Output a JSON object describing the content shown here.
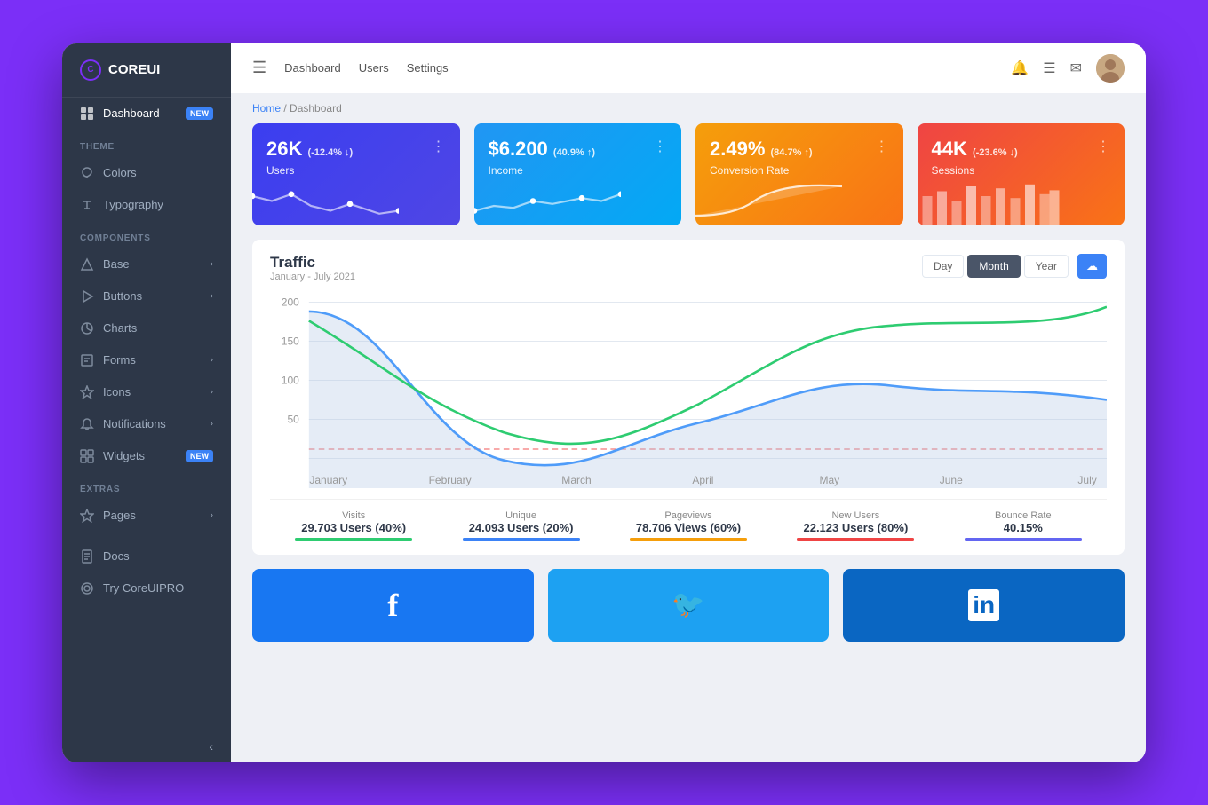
{
  "app": {
    "name": "COREUI"
  },
  "header": {
    "menu_icon": "☰",
    "nav_items": [
      "Dashboard",
      "Users",
      "Settings"
    ],
    "bell_icon": "🔔",
    "list_icon": "☰",
    "mail_icon": "✉"
  },
  "breadcrumb": {
    "home": "Home",
    "separator": "/",
    "current": "Dashboard"
  },
  "stat_cards": [
    {
      "value": "26K",
      "change": "(-12.4% ↓)",
      "label": "Users",
      "color": "card-blue"
    },
    {
      "value": "$6.200",
      "change": "(40.9% ↑)",
      "label": "Income",
      "color": "card-sky"
    },
    {
      "value": "2.49%",
      "change": "(84.7% ↑)",
      "label": "Conversion Rate",
      "color": "card-orange"
    },
    {
      "value": "44K",
      "change": "(-23.6% ↓)",
      "label": "Sessions",
      "color": "card-red"
    }
  ],
  "traffic": {
    "title": "Traffic",
    "subtitle": "January - July 2021",
    "time_buttons": [
      "Day",
      "Month",
      "Year"
    ],
    "active_time": "Month",
    "export_icon": "☁",
    "x_labels": [
      "January",
      "February",
      "March",
      "April",
      "May",
      "June",
      "July"
    ],
    "y_labels": [
      "200",
      "150",
      "100",
      "50"
    ],
    "stats": [
      {
        "label": "Visits",
        "value": "29.703 Users (40%)",
        "bar_color": "#2ecc71"
      },
      {
        "label": "Unique",
        "value": "24.093 Users (20%)",
        "bar_color": "#3b82f6"
      },
      {
        "label": "Pageviews",
        "value": "78.706 Views (60%)",
        "bar_color": "#f59e0b"
      },
      {
        "label": "New Users",
        "value": "22.123 Users (80%)",
        "bar_color": "#ef4444"
      },
      {
        "label": "Bounce Rate",
        "value": "40.15%",
        "bar_color": "#6366f1"
      }
    ]
  },
  "sidebar": {
    "logo_text": "COREUI",
    "dashboard": {
      "label": "Dashboard",
      "badge": "NEW"
    },
    "theme_label": "THEME",
    "theme_items": [
      {
        "label": "Colors",
        "icon": "droplet"
      },
      {
        "label": "Typography",
        "icon": "pen"
      }
    ],
    "components_label": "COMPONENTS",
    "component_items": [
      {
        "label": "Base",
        "has_chevron": true
      },
      {
        "label": "Buttons",
        "has_chevron": true
      },
      {
        "label": "Charts",
        "has_chevron": false
      },
      {
        "label": "Forms",
        "has_chevron": true
      },
      {
        "label": "Icons",
        "has_chevron": true
      },
      {
        "label": "Notifications",
        "has_chevron": true
      },
      {
        "label": "Widgets",
        "badge": "NEW"
      }
    ],
    "extras_label": "EXTRAS",
    "extras_items": [
      {
        "label": "Pages",
        "has_chevron": true
      }
    ],
    "bottom_items": [
      {
        "label": "Docs"
      },
      {
        "label": "Try CoreUIPRO"
      }
    ],
    "collapse_icon": "‹"
  },
  "social": [
    {
      "label": "Facebook",
      "icon": "f",
      "color": "social-fb"
    },
    {
      "label": "Twitter",
      "icon": "🐦",
      "color": "social-tw"
    },
    {
      "label": "LinkedIn",
      "icon": "in",
      "color": "social-li"
    }
  ]
}
